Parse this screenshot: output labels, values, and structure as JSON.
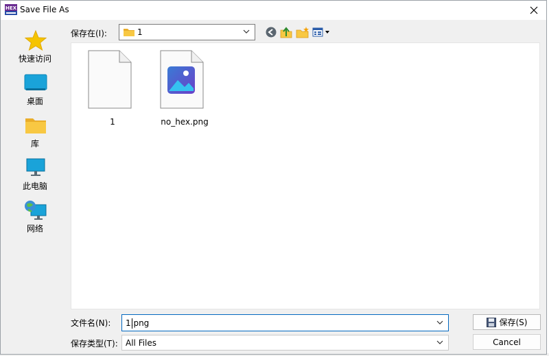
{
  "window": {
    "title": "Save File As"
  },
  "places": [
    {
      "label": "快速访问",
      "icon": "star-icon"
    },
    {
      "label": "桌面",
      "icon": "desktop-icon"
    },
    {
      "label": "库",
      "icon": "library-folder-icon"
    },
    {
      "label": "此电脑",
      "icon": "this-pc-icon"
    },
    {
      "label": "网络",
      "icon": "network-icon"
    }
  ],
  "location": {
    "label": "保存在(I):",
    "current": "1"
  },
  "files": [
    {
      "name": "1",
      "type": "blank-file"
    },
    {
      "name": "no_hex.png",
      "type": "image-file"
    }
  ],
  "form": {
    "filename_label": "文件名(N):",
    "filename_value": "1.png",
    "filetype_label": "保存类型(T):",
    "filetype_value": "All Files"
  },
  "buttons": {
    "save": "保存(S)",
    "cancel": "Cancel"
  },
  "colors": {
    "accent": "#0067c0",
    "star": "#f5c400",
    "folder": "#f8c843"
  }
}
